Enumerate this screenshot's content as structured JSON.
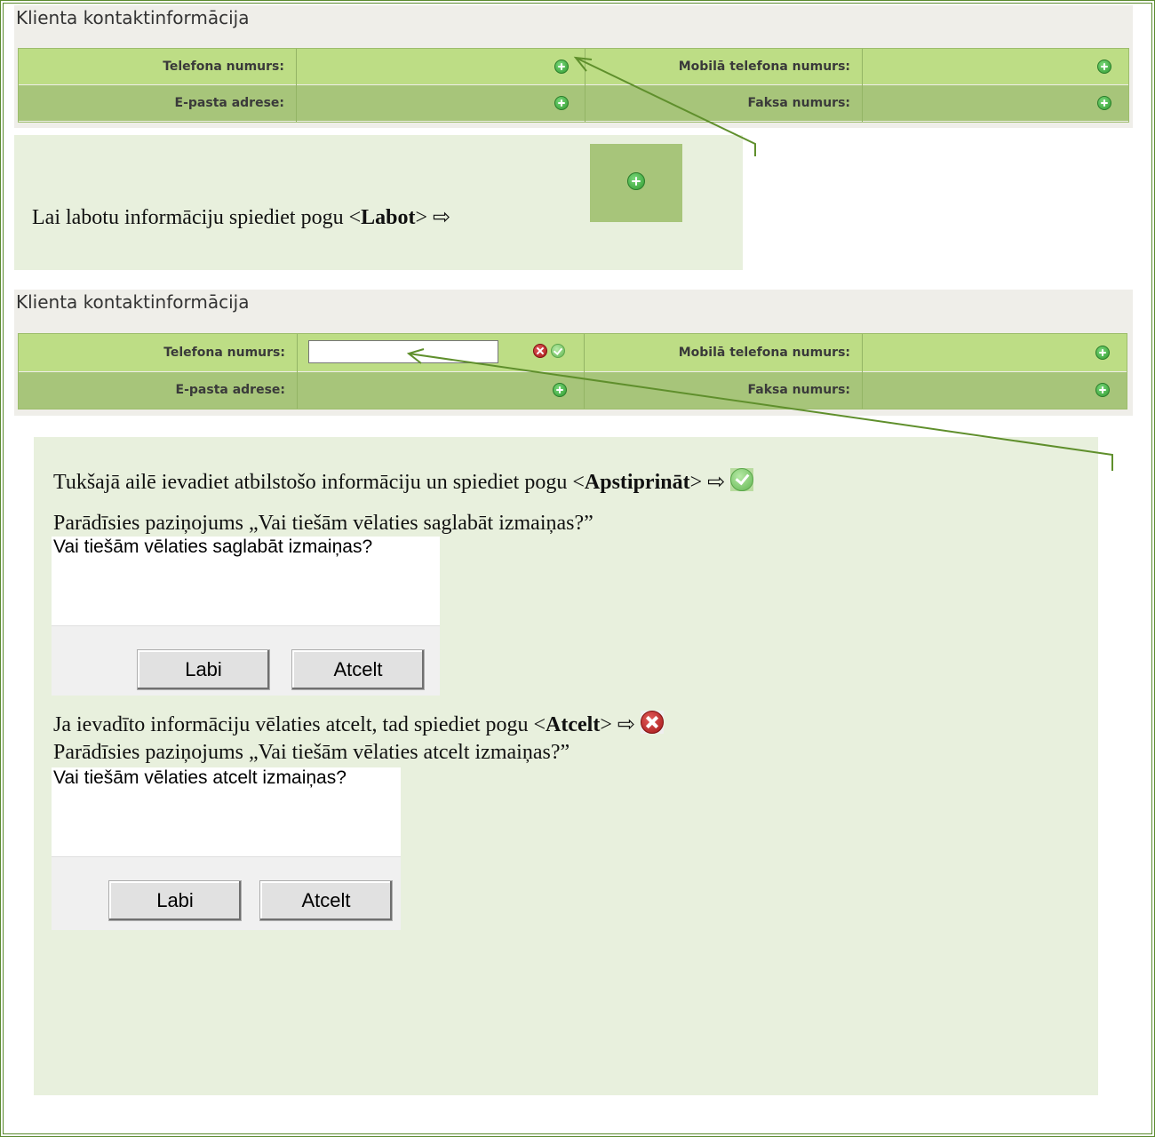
{
  "panel1": {
    "title": "Klienta kontaktinformācija",
    "rows": [
      {
        "label_left": "Telefona numurs:",
        "label_right": "Mobilā telefona numurs:"
      },
      {
        "label_left": "E-pasta adrese:",
        "label_right": "Faksa numurs:"
      }
    ]
  },
  "note1": {
    "text_before": "Lai labotu informāciju spiediet pogu <",
    "bold": "Labot",
    "text_after": "> ⇨",
    "icon": "plus-icon"
  },
  "panel2": {
    "title": "Klienta kontaktinformācija",
    "rows": [
      {
        "label_left": "Telefona numurs:",
        "input_value": "",
        "label_right": "Mobilā telefona numurs:"
      },
      {
        "label_left": "E-pasta adrese:",
        "label_right": "Faksa numurs:"
      }
    ]
  },
  "note2": {
    "line1_before": "Tukšajā ailē ievadiet atbilstošo informāciju un spiediet pogu <",
    "line1_bold": "Apstiprināt",
    "line1_after": "> ⇨",
    "line2": "Parādīsies paziņojums „Vai tiešām vēlaties saglabāt izmaiņas?”",
    "dialog1": {
      "message": "Vai tiešām vēlaties saglabāt izmaiņas?",
      "ok": "Labi",
      "cancel": "Atcelt"
    },
    "line3_before": "Ja ievadīto informāciju vēlaties atcelt, tad spiediet pogu <",
    "line3_bold": "Atcelt",
    "line3_after": "> ⇨",
    "line4": "Parādīsies paziņojums „Vai tiešām vēlaties atcelt izmaiņas?”",
    "dialog2": {
      "message": "Vai tiešām vēlaties atcelt izmaiņas?",
      "ok": "Labi",
      "cancel": "Atcelt"
    }
  },
  "colors": {
    "row_light": "#bddd85",
    "row_dark": "#a7c57a",
    "note_bg": "#e8f0dd",
    "border": "#5a8a2e"
  }
}
